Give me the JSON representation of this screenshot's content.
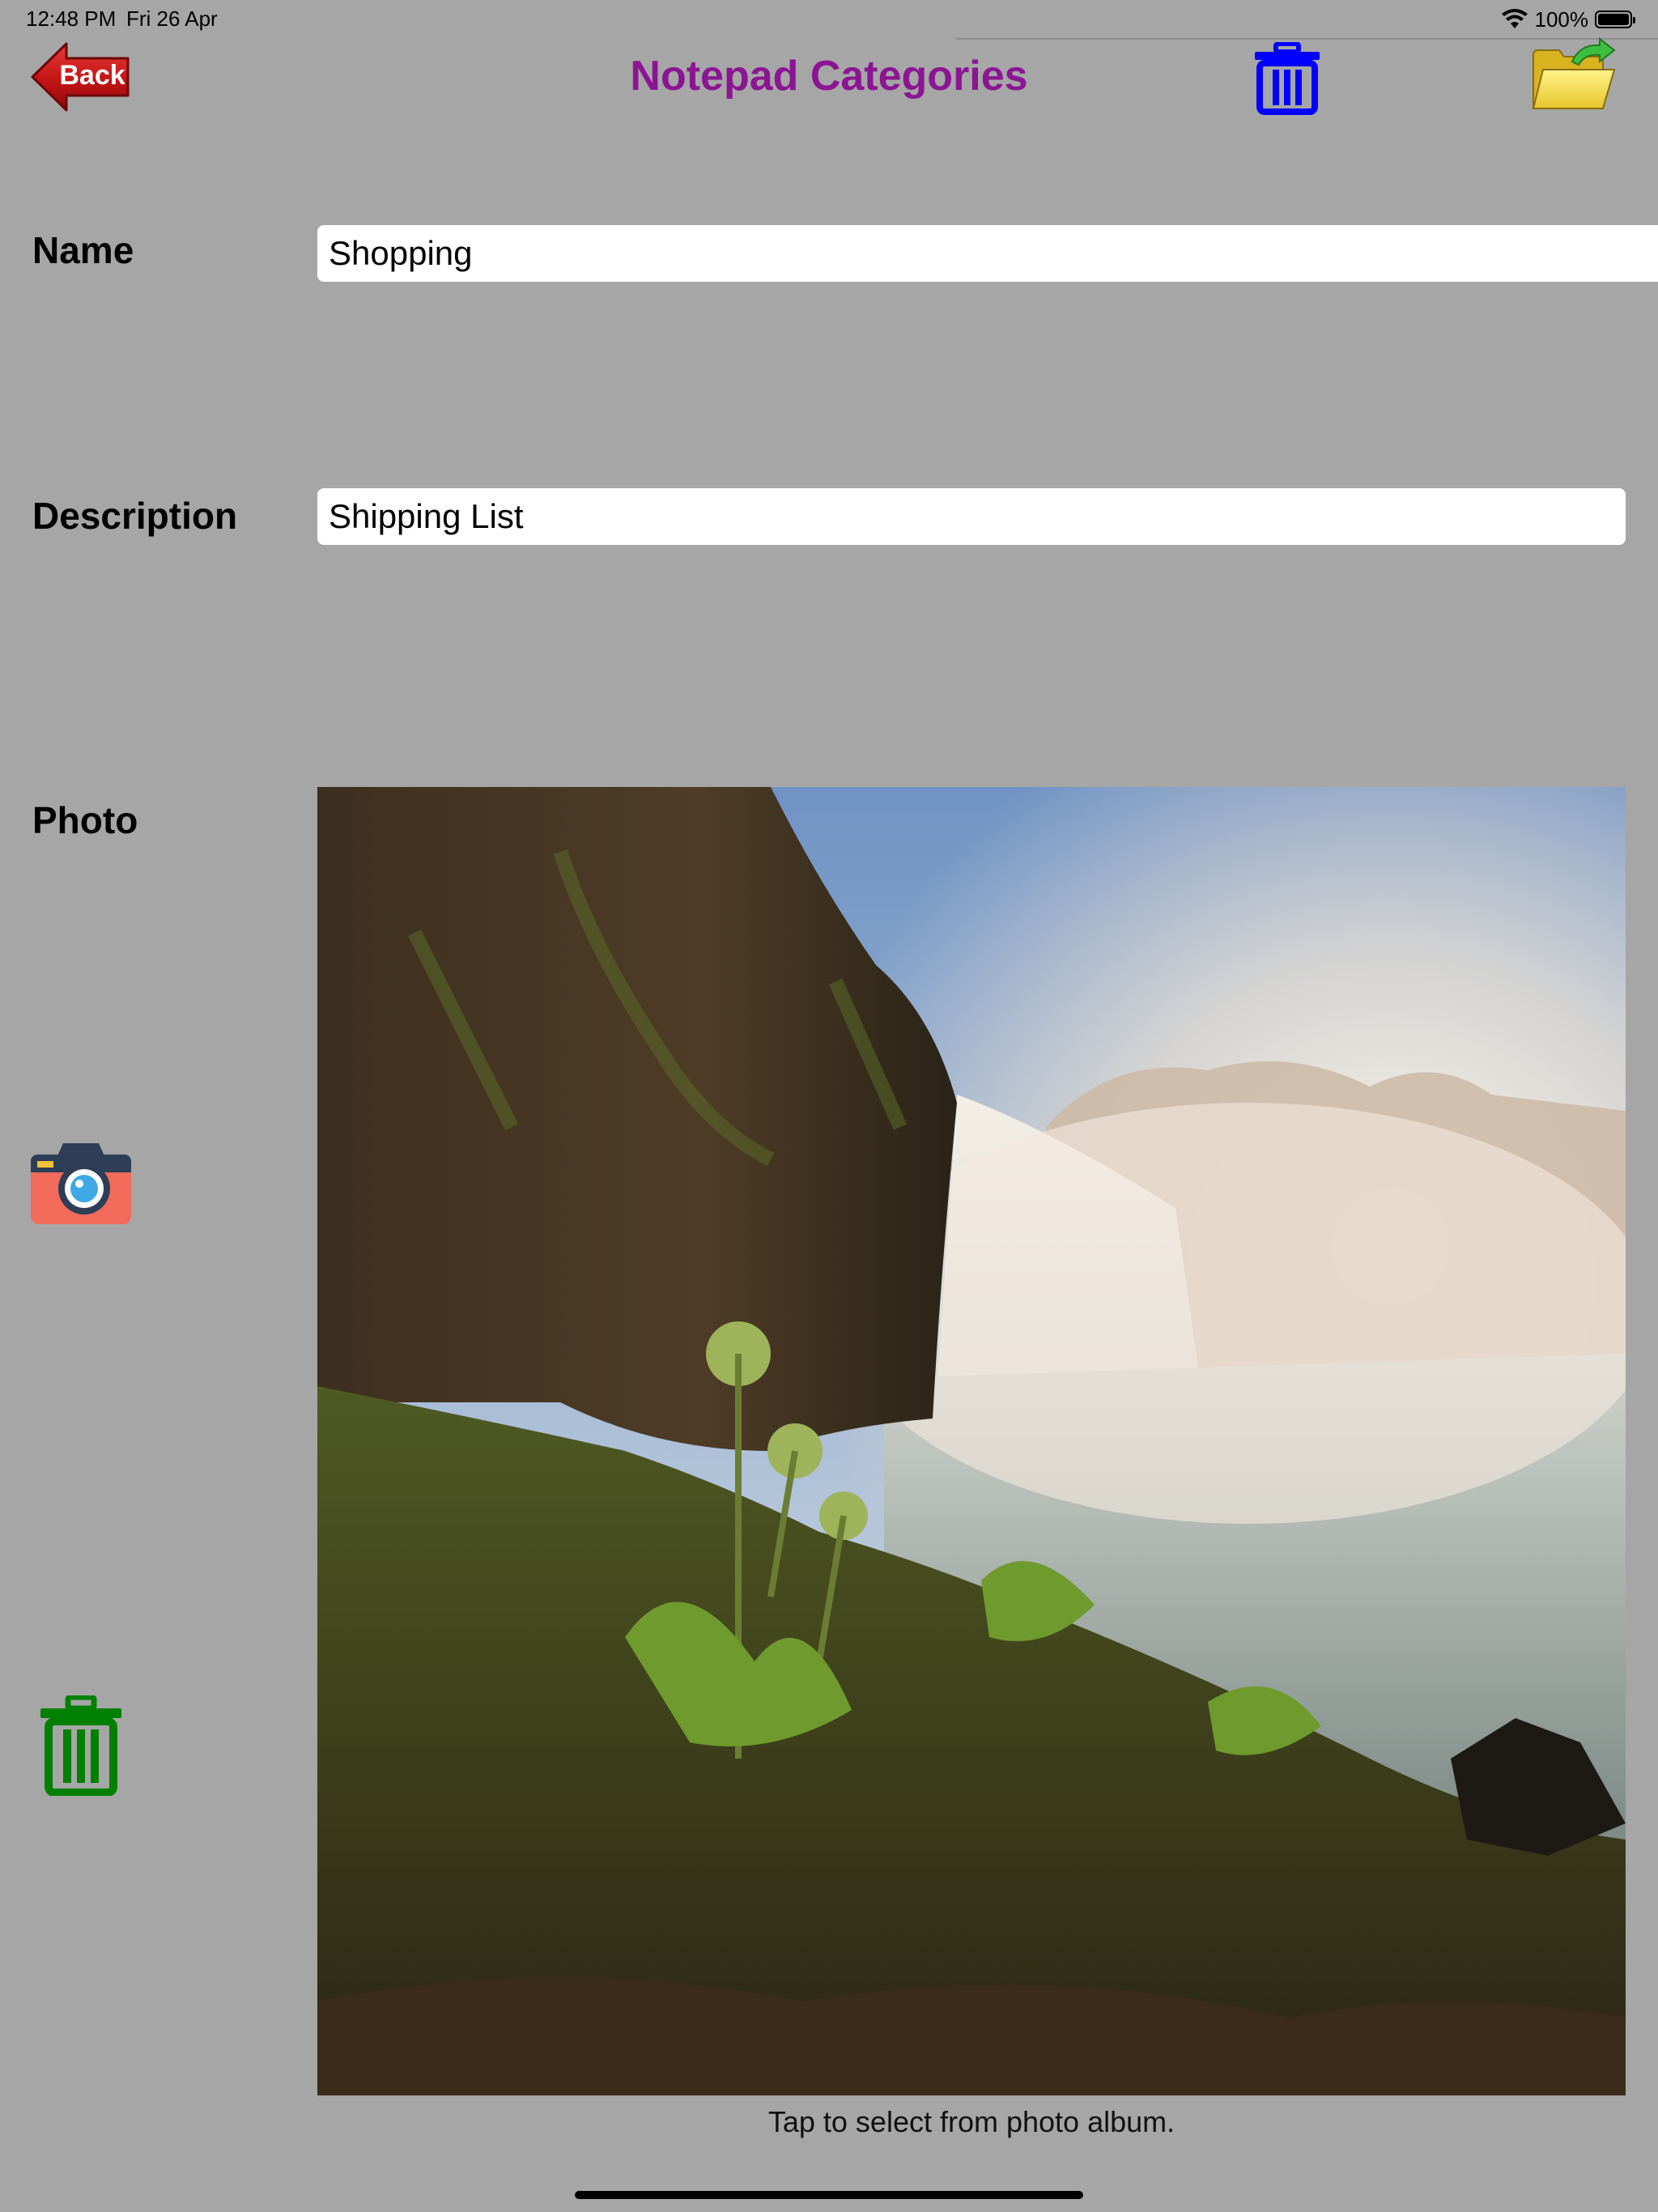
{
  "status_bar": {
    "time": "12:48 PM",
    "date": "Fri 26 Apr",
    "battery_text": "100%",
    "icons": [
      "wifi-icon",
      "battery-icon"
    ]
  },
  "header": {
    "back_label": "Back",
    "title": "Notepad Categories",
    "icons": [
      "back-arrow-icon",
      "trash-icon",
      "folder-icon",
      "refresh-arrow-icon"
    ]
  },
  "form": {
    "name_label": "Name",
    "name_value": "Shopping",
    "description_label": "Description",
    "description_value": "Shipping List",
    "photo_label": "Photo",
    "photo_hint": "Tap to select from photo album.",
    "icons": [
      "camera-icon",
      "trash-icon"
    ]
  },
  "colors": {
    "background": "#a6a6a6",
    "title": "#8b1593",
    "header_trash": "#0000ff",
    "photo_trash": "#008000",
    "back_arrow": "#cc1b1b"
  }
}
